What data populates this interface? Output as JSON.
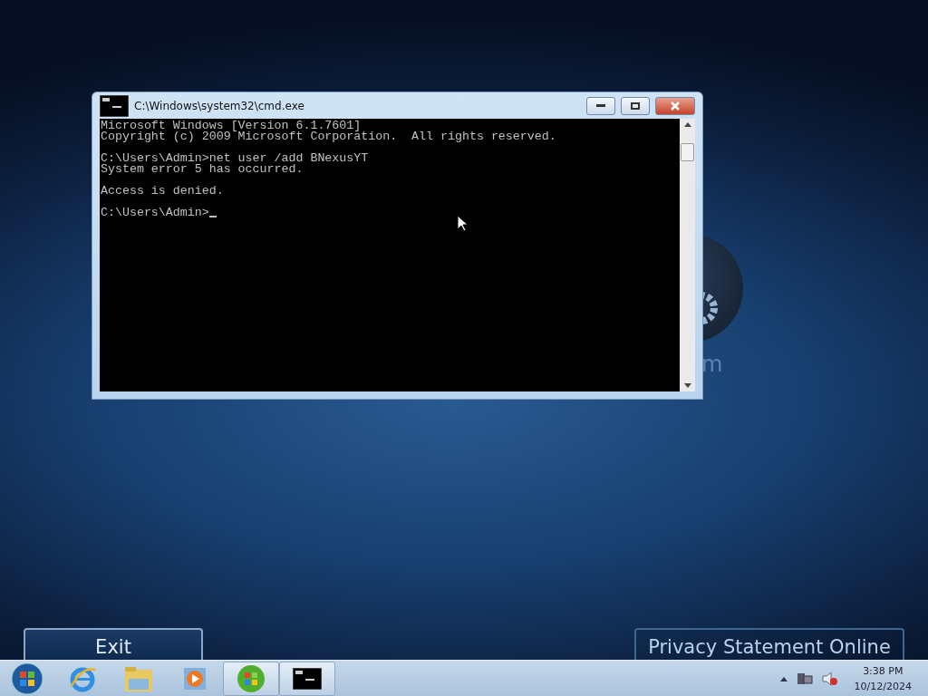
{
  "background": {
    "fragment": "m"
  },
  "window": {
    "title": "C:\\Windows\\system32\\cmd.exe"
  },
  "console": {
    "blocks": [
      [
        "Microsoft Windows [Version 6.1.7601]",
        "Copyright (c) 2009 Microsoft Corporation.  All rights reserved."
      ],
      [
        "C:\\Users\\Admin>net user /add BNexusYT",
        "System error 5 has occurred."
      ],
      [
        "Access is denied."
      ],
      [
        "C:\\Users\\Admin>"
      ]
    ],
    "cursor": true
  },
  "exit_button": "Exit",
  "privacy_button": "Privacy Statement Online",
  "taskbar": {
    "items": [
      {
        "kind": "start",
        "selected": false
      },
      {
        "kind": "browser",
        "selected": false
      },
      {
        "kind": "folder",
        "selected": false
      },
      {
        "kind": "media",
        "selected": false
      },
      {
        "kind": "orb",
        "selected": true
      },
      {
        "kind": "console",
        "selected": true
      }
    ],
    "clock": {
      "time": "3:38 PM",
      "date": "10/12/2024"
    }
  }
}
